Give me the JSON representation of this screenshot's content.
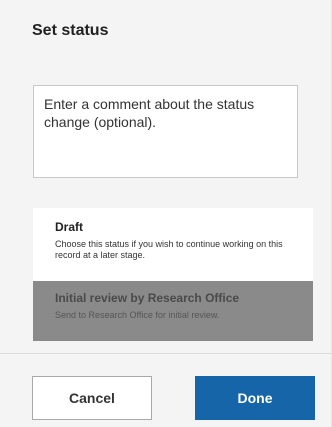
{
  "dialog": {
    "title": "Set status"
  },
  "comment": {
    "placeholder": "Enter a comment about the status change (optional)."
  },
  "status_options": [
    {
      "name": "Draft",
      "description": "Choose this status if you wish to continue working on this record at a later stage.",
      "state": "available"
    },
    {
      "name": "Initial review by Research Office",
      "description": "Send to Research Office for initial review.",
      "state": "selected-disabled"
    }
  ],
  "buttons": {
    "cancel_label": "Cancel",
    "done_label": "Done"
  },
  "colors": {
    "primary": "#1565a8",
    "selected_option_bg": "#8a8a8a"
  }
}
